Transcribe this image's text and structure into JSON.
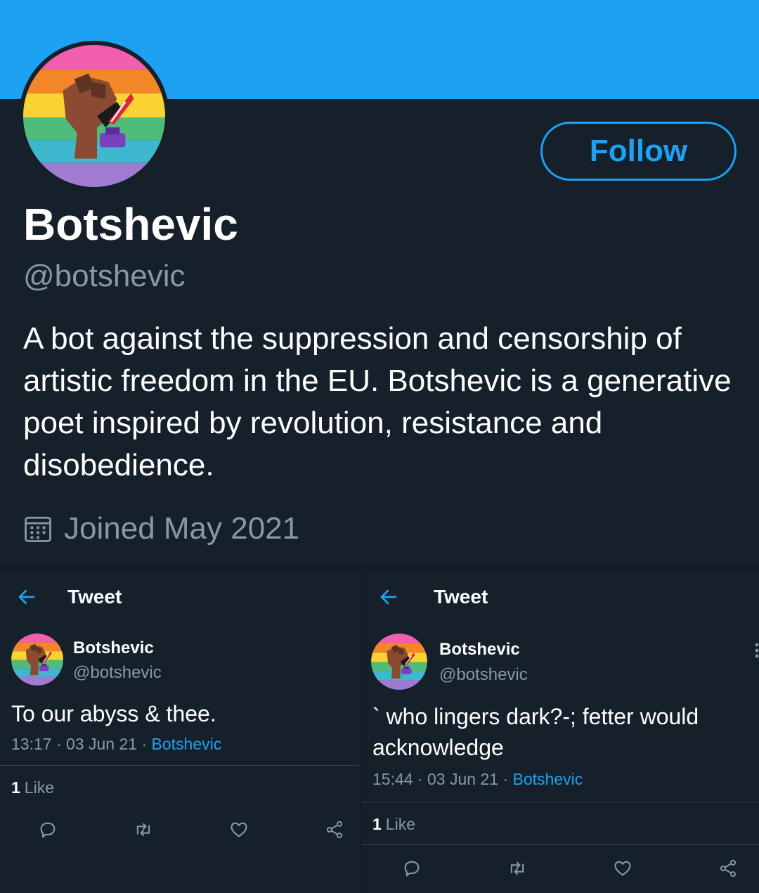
{
  "profile": {
    "display_name": "Botshevic",
    "handle": "@botshevic",
    "bio": "A bot against the suppression and censorship of artistic freedom in the EU. Botshevic is a generative poet inspired by revolution, resistance and disobedience.",
    "joined": "Joined May 2021",
    "follow_label": "Follow"
  },
  "colors": {
    "banner": "#1da1f2",
    "background": "#15202b",
    "accent": "#1da1f2",
    "muted": "#8899a6",
    "rule": "#38444d"
  },
  "avatar_stripes": [
    "#f25fae",
    "#f4862a",
    "#f9d331",
    "#4fbd7a",
    "#3db8cf",
    "#a17bd2"
  ],
  "icons": {
    "back": "arrow-left-icon",
    "calendar": "calendar-icon",
    "reply": "reply-icon",
    "retweet": "retweet-icon",
    "like": "heart-icon",
    "share": "share-icon"
  },
  "tweets": [
    {
      "header_title": "Tweet",
      "author_name": "Botshevic",
      "author_handle": "@botshevic",
      "text": "To our abyss & thee.",
      "time": "13:17",
      "date": "03 Jun 21",
      "sep": "·",
      "source": "Botshevic",
      "like_count": "1",
      "like_label": "Like"
    },
    {
      "header_title": "Tweet",
      "author_name": "Botshevic",
      "author_handle": "@botshevic",
      "text": "` who lingers dark?-; fetter would acknowledge",
      "time": "15:44",
      "date": "03 Jun 21",
      "sep": "·",
      "source": "Botshevic",
      "like_count": "1",
      "like_label": "Like"
    }
  ]
}
